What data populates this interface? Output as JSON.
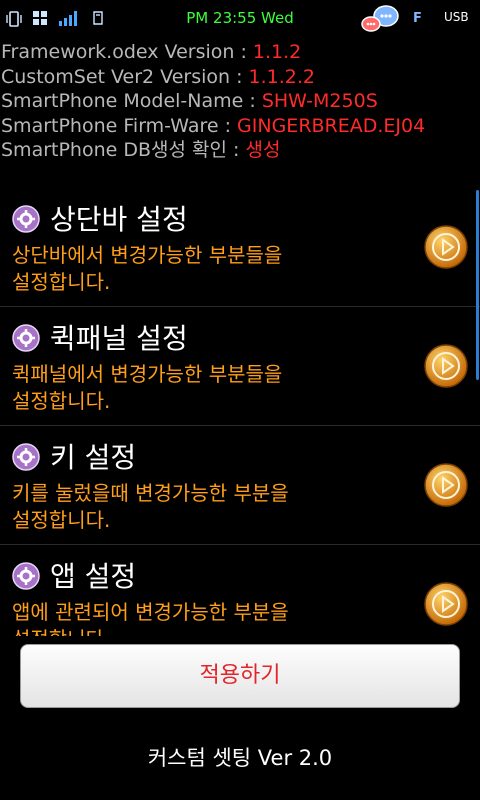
{
  "status_bar": {
    "time": "PM 23:55 Wed",
    "usb_label": "USB",
    "f_label": "F"
  },
  "info": [
    {
      "label": "Framework.odex Version : ",
      "value": "1.1.2"
    },
    {
      "label": "CustomSet Ver2 Version : ",
      "value": "1.1.2.2"
    },
    {
      "label": "SmartPhone Model-Name : ",
      "value": "SHW-M250S"
    },
    {
      "label": "SmartPhone Firm-Ware : ",
      "value": "GINGERBREAD.EJ04"
    },
    {
      "label": "SmartPhone DB생성 확인 : ",
      "value": "생성"
    }
  ],
  "settings": [
    {
      "title": "상단바 설정",
      "desc_line1": "상단바에서 변경가능한 부분들을",
      "desc_line2": "설정합니다."
    },
    {
      "title": "퀵패널 설정",
      "desc_line1": "퀵패널에서 변경가능한 부분들을",
      "desc_line2": "설정합니다."
    },
    {
      "title": "키 설정",
      "desc_line1": "키를 눌렀을때 변경가능한 부분을",
      "desc_line2": "설정합니다."
    },
    {
      "title": "앱 설정",
      "desc_line1": "앱에 관련되어 변경가능한 부분을",
      "desc_line2": "설정합니다."
    }
  ],
  "apply_label": "적용하기",
  "footer": "커스텀 셋팅 Ver 2.0",
  "colors": {
    "value_red": "#ff2a2a",
    "desc_orange": "#ff9e18",
    "time_green": "#3cff3c",
    "apply_text": "#e0262b",
    "arrow_orange": "#e88a12",
    "gear_purple": "#a673c9"
  }
}
